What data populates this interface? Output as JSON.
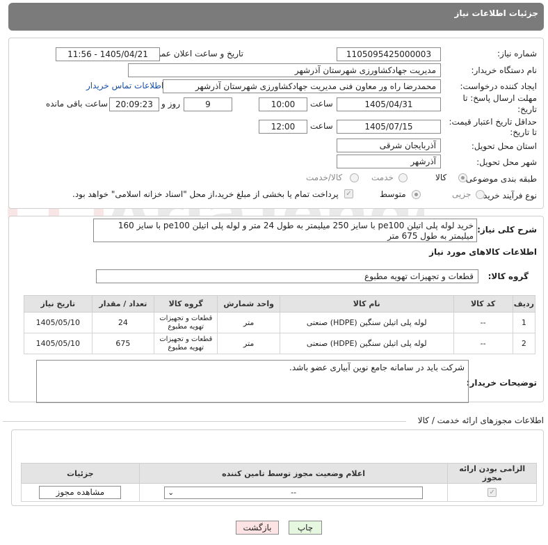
{
  "header": {
    "title": "جزئیات اطلاعات نیاز"
  },
  "form": {
    "need_number": {
      "label": "شماره نیاز:",
      "value": "1105095425000003"
    },
    "announce_datetime": {
      "label": "تاریخ و ساعت اعلان عمومی:",
      "value": "1405/04/21 - 11:56"
    },
    "buyer_org": {
      "label": "نام دستگاه خریدار:",
      "value": "مدیریت جهادکشاورزی شهرستان آذرشهر"
    },
    "requester": {
      "label": "ایجاد کننده درخواست:",
      "value": "محمدرضا راه ور معاون فنی مدیریت جهادکشاورزی شهرستان آذرشهر",
      "contact_link": "اطلاعات تماس خریدار"
    },
    "deadline": {
      "label_line1": "مهلت ارسال پاسخ: تا",
      "label_line2": "تاریخ:",
      "date": "1405/04/31",
      "time_label": "ساعت",
      "time": "10:00",
      "days": "9",
      "days_label": "روز و",
      "remaining": "20:09:23",
      "remaining_label": "ساعت باقی مانده"
    },
    "validity": {
      "label_line1": "حداقل تاریخ اعتبار قیمت:",
      "label_line2": "تا تاریخ:",
      "date": "1405/07/15",
      "time_label": "ساعت",
      "time": "12:00"
    },
    "delivery_province": {
      "label": "استان محل تحویل:",
      "value": "آذربایجان شرقی"
    },
    "delivery_city": {
      "label": "شهر محل تحویل:",
      "value": "آذرشهر"
    },
    "category": {
      "label": "طبقه بندی موضوعی:",
      "options": [
        "کالا",
        "خدمت",
        "کالا/خدمت"
      ],
      "selected": "کالا"
    },
    "process_type": {
      "label": "نوع فرآیند خرید :",
      "options": [
        "جزیی",
        "متوسط"
      ],
      "selected": "متوسط",
      "payment_note": "پرداخت تمام یا بخشی از مبلغ خرید،از محل \"اسناد خزانه اسلامی\" خواهد بود."
    }
  },
  "description": {
    "label": "شرح کلی نیاز:",
    "value": "خرید لوله پلی اتیلن pe100 با سایز 250 میلیمتر به طول 24 متر و لوله پلی اتیلن pe100 با سایز 160 میلیمتر به طول 675 متر"
  },
  "goods_info": {
    "section_title": "اطلاعات کالاهای مورد نیاز",
    "group_label": "گروه کالا:",
    "group_value": "قطعات و تجهیزات تهویه مطبوع",
    "columns": [
      "ردیف",
      "کد کالا",
      "نام کالا",
      "واحد شمارش",
      "گروه کالا",
      "تعداد / مقدار",
      "تاریخ نیاز"
    ],
    "rows": [
      {
        "row": "1",
        "code": "--",
        "name": "لوله پلی اتیلن سنگین (HDPE) صنعتی",
        "unit": "متر",
        "group": "قطعات و تجهیزات تهویه مطبوع",
        "qty": "24",
        "date": "1405/05/10"
      },
      {
        "row": "2",
        "code": "--",
        "name": "لوله پلی اتیلن سنگین (HDPE) صنعتی",
        "unit": "متر",
        "group": "قطعات و تجهیزات تهویه مطبوع",
        "qty": "675",
        "date": "1405/05/10"
      }
    ]
  },
  "buyer_notes": {
    "label": "توضیحات خریدار:",
    "value": "شرکت باید در سامانه جامع نوین آبیاری عضو باشد."
  },
  "permits": {
    "section_title": "اطلاعات مجوزهای ارائه خدمت / کالا",
    "columns": [
      "الزامی بودن ارائه مجوز",
      "اعلام وضعیت مجوز توسط تامین کننده",
      "جزئیات"
    ],
    "select_value": "--",
    "view_button": "مشاهده مجوز"
  },
  "buttons": {
    "print": "چاپ",
    "back": "بازگشت"
  },
  "colors": {
    "header_bg": "#7b7b7b",
    "link": "#1a4fa3",
    "back_bg": "#fde3e3",
    "print_bg": "#e6f7e0"
  }
}
